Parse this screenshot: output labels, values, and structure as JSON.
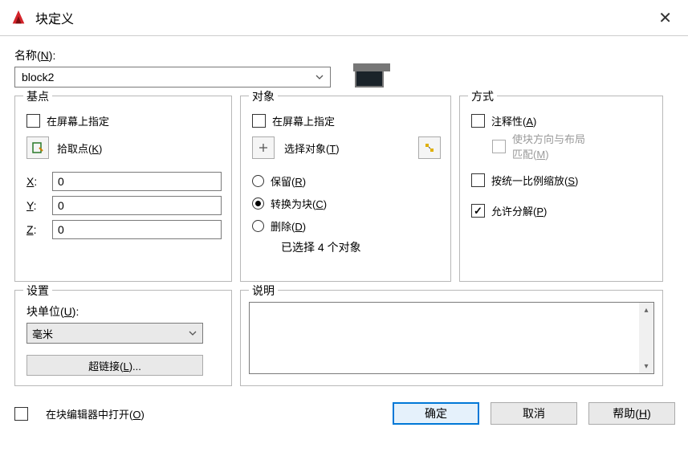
{
  "title": "块定义",
  "name": {
    "label": "名称(N):",
    "value": "block2"
  },
  "basepoint": {
    "legend": "基点",
    "specify_on_screen": "在屏幕上指定",
    "pick_point": "拾取点(K)",
    "x_label": "X:",
    "y_label": "Y:",
    "z_label": "Z:",
    "x": "0",
    "y": "0",
    "z": "0"
  },
  "objects": {
    "legend": "对象",
    "specify_on_screen": "在屏幕上指定",
    "select_objects": "选择对象(T)",
    "retain": "保留(R)",
    "convert": "转换为块(C)",
    "delete": "删除(D)",
    "count_text": "已选择 4 个对象"
  },
  "mode": {
    "legend": "方式",
    "annotative": "注释性(A)",
    "match_orient": "使块方向与布局匹配(M)",
    "uniform_scale": "按统一比例缩放(S)",
    "allow_explode": "允许分解(P)"
  },
  "settings": {
    "legend": "设置",
    "unit_label": "块单位(U):",
    "unit_value": "毫米",
    "hyperlink": "超链接(L)..."
  },
  "description": {
    "legend": "说明"
  },
  "open_in_editor": "在块编辑器中打开(O)",
  "buttons": {
    "ok": "确定",
    "cancel": "取消",
    "help": "帮助(H)"
  }
}
